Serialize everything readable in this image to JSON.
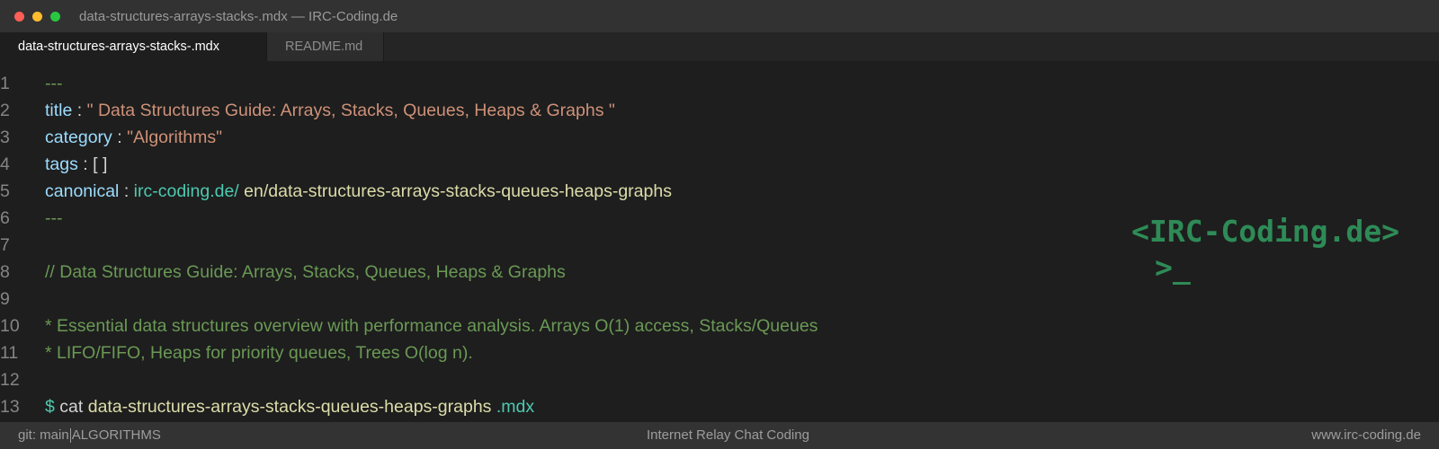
{
  "window": {
    "title": "data-structures-arrays-stacks-.mdx — IRC-Coding.de"
  },
  "tabs": [
    {
      "label": "data-structures-arrays-stacks-.mdx",
      "active": true
    },
    {
      "label": "README.md",
      "active": false
    }
  ],
  "editor": {
    "line_numbers": [
      "1",
      "2",
      "3",
      "4",
      "5",
      "6",
      "7",
      "8",
      "9",
      "10",
      "11",
      "12",
      "13"
    ],
    "frontmatter_delimiter": "---",
    "title_key": "title",
    "title_value": "\" Data Structures Guide: Arrays, Stacks, Queues, Heaps & Graphs \"",
    "category_key": "category",
    "category_value": "\"Algorithms\"",
    "tags_key": "tags",
    "tags_value": "[ ]",
    "canonical_key": "canonical",
    "canonical_domain": "irc-coding.de/",
    "canonical_path": "en/data-structures-arrays-stacks-queues-heaps-graphs",
    "separator": ":",
    "comment_line": "// Data Structures Guide: Arrays, Stacks, Queues, Heaps & Graphs",
    "description_line_1": "* Essential data structures overview with performance analysis. Arrays O(1) access, Stacks/Queues",
    "description_line_2": "* LIFO/FIFO, Heaps for priority queues, Trees O(log n).",
    "prompt_symbol": "$",
    "command": "cat",
    "command_file": "data-structures-arrays-stacks-queues-heaps-graphs",
    "command_ext": ".mdx"
  },
  "logo": {
    "text": "<IRC-Coding.de>",
    "prompt": ">_"
  },
  "statusbar": {
    "branch": "git: main",
    "category": "ALGORITHMS",
    "center": "Internet Relay Chat Coding",
    "right": "www.irc-coding.de"
  },
  "colors": {
    "background": "#1e1e1e",
    "key": "#9cdcfe",
    "string": "#ce9178",
    "comment": "#6a9955",
    "teal": "#4ec9b0",
    "logo": "#2e8b57"
  }
}
